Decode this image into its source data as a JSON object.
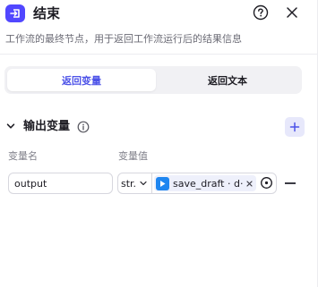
{
  "header": {
    "title": "结束",
    "description": "工作流的最终节点，用于返回工作流运行后的结果信息"
  },
  "tabs": [
    {
      "label": "返回变量",
      "active": true
    },
    {
      "label": "返回文本",
      "active": false
    }
  ],
  "output_section": {
    "title": "输出变量",
    "columns": {
      "name": "变量名",
      "value": "变量值"
    },
    "rows": [
      {
        "name": "output",
        "type": "str.",
        "reference": "save_draft · d·"
      }
    ]
  },
  "colors": {
    "accent": "#4d53e8",
    "node_icon": "#5147ff",
    "ref_icon": "#1f86f0"
  },
  "icons": [
    "end-node-icon",
    "help-icon",
    "close-icon",
    "chevron-down-icon",
    "info-icon",
    "plus-icon",
    "plugin-icon",
    "clear-icon",
    "target-icon",
    "minus-icon"
  ]
}
